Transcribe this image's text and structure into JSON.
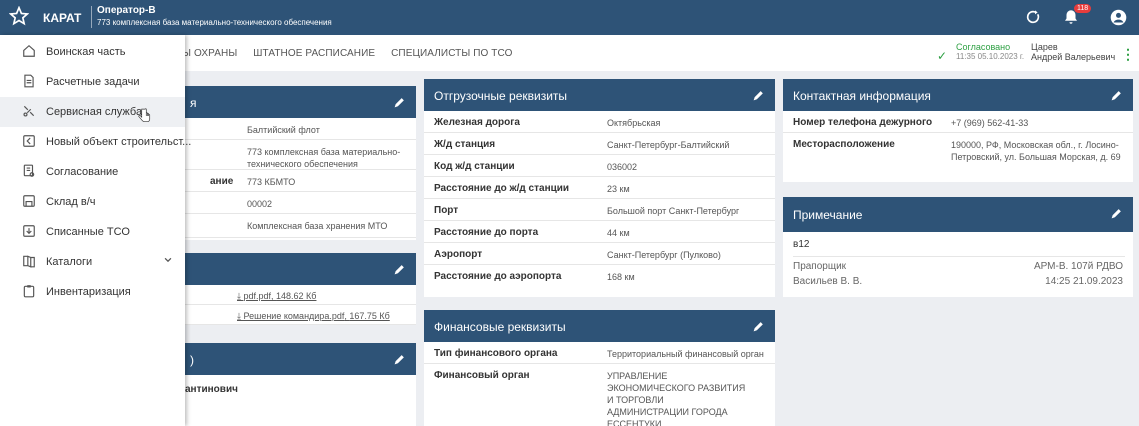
{
  "topbar": {
    "app_name": "КАРАТ",
    "user_name": "Оператор-В",
    "org_name": "773 комплексная база материально-технического обеспечения",
    "notification_count": "118",
    "colors": {
      "primary": "#2e5377",
      "badge": "#e73c3c"
    }
  },
  "subnav": {
    "tabs": [
      "КТЫ ОХРАНЫ",
      "ШТАТНОЕ РАСПИСАНИЕ",
      "СПЕЦИАЛИСТЫ ПО ТСО"
    ],
    "status_label": "Согласовано",
    "status_time": "11:35 05.10.2023 г.",
    "approver_last": "Царев",
    "approver_first": "Андрей Валерьевич",
    "status_color": "#2ea043"
  },
  "sidebar": {
    "items": [
      {
        "label": "Воинская часть",
        "icon": "home-icon"
      },
      {
        "label": "Расчетные задачи",
        "icon": "document-icon"
      },
      {
        "label": "Сервисная служба",
        "icon": "wrench-icon"
      },
      {
        "label": "Новый объект строительст...",
        "icon": "new-object-icon"
      },
      {
        "label": "Согласование",
        "icon": "approval-icon"
      },
      {
        "label": "Склад в/ч",
        "icon": "warehouse-icon"
      },
      {
        "label": "Списанные ТСО",
        "icon": "writeoff-icon"
      },
      {
        "label": "Каталоги",
        "icon": "book-icon"
      },
      {
        "label": "Инвентаризация",
        "icon": "clipboard-icon"
      }
    ]
  },
  "left_cards": {
    "card1": {
      "title_fragment": "я",
      "rows": [
        {
          "key": "",
          "value": "Балтийский флот"
        },
        {
          "key": "",
          "value": "773 комплексная база материально-технического обеспечения"
        },
        {
          "key": "ание",
          "value": "773 КБМТО"
        },
        {
          "key": "",
          "value": "00002"
        },
        {
          "key": "",
          "value": "Комплексная база хранения МТО"
        }
      ]
    },
    "card2": {
      "files": [
        {
          "name": "pdf.pdf",
          "size": "148.62 Кб"
        },
        {
          "name": "Решение командира.pdf",
          "size": "167.75 Кб"
        }
      ]
    },
    "card3": {
      "title_fragment": ")",
      "row_key": "антинович"
    }
  },
  "shipping": {
    "title": "Отгрузочные реквизиты",
    "rows": [
      {
        "key": "Железная дорога",
        "value": "Октябрьская"
      },
      {
        "key": "Ж/д станция",
        "value": "Санкт-Петербург-Балтийский"
      },
      {
        "key": "Код ж/д станции",
        "value": "036002"
      },
      {
        "key": "Расстояние до ж/д станции",
        "value": "23 км"
      },
      {
        "key": "Порт",
        "value": "Большой порт Санкт-Петербург"
      },
      {
        "key": "Расстояние до порта",
        "value": "44 км"
      },
      {
        "key": "Аэропорт",
        "value": "Санкт-Петербург (Пулково)"
      },
      {
        "key": "Расстояние до аэропорта",
        "value": "168 км"
      }
    ]
  },
  "finance": {
    "title": "Финансовые реквизиты",
    "rows": [
      {
        "key": "Тип финансового органа",
        "value": "Территориальный финансовый орган"
      },
      {
        "key": "Финансовый орган",
        "value": "УПРАВЛЕНИЕ ЭКОНОМИЧЕСКОГО РАЗВИТИЯ И ТОРГОВЛИ АДМИНИСТРАЦИИ ГОРОДА ЕССЕНТУКИ"
      }
    ]
  },
  "contacts": {
    "title": "Контактная информация",
    "rows": [
      {
        "key": "Номер телефона дежурного",
        "value": "+7 (969) 562-41-33"
      },
      {
        "key": "Месторасположение",
        "value": "190000, РФ, Московская обл., г. Лосино-Петровский, ул. Большая Морская, д. 69"
      }
    ]
  },
  "note": {
    "title": "Примечание",
    "text": "в12",
    "author_rank": "Прапорщик",
    "author_name": "Васильев В. В.",
    "station": "АРМ-В. 107й РДВО",
    "datetime": "14:25 21.09.2023"
  }
}
